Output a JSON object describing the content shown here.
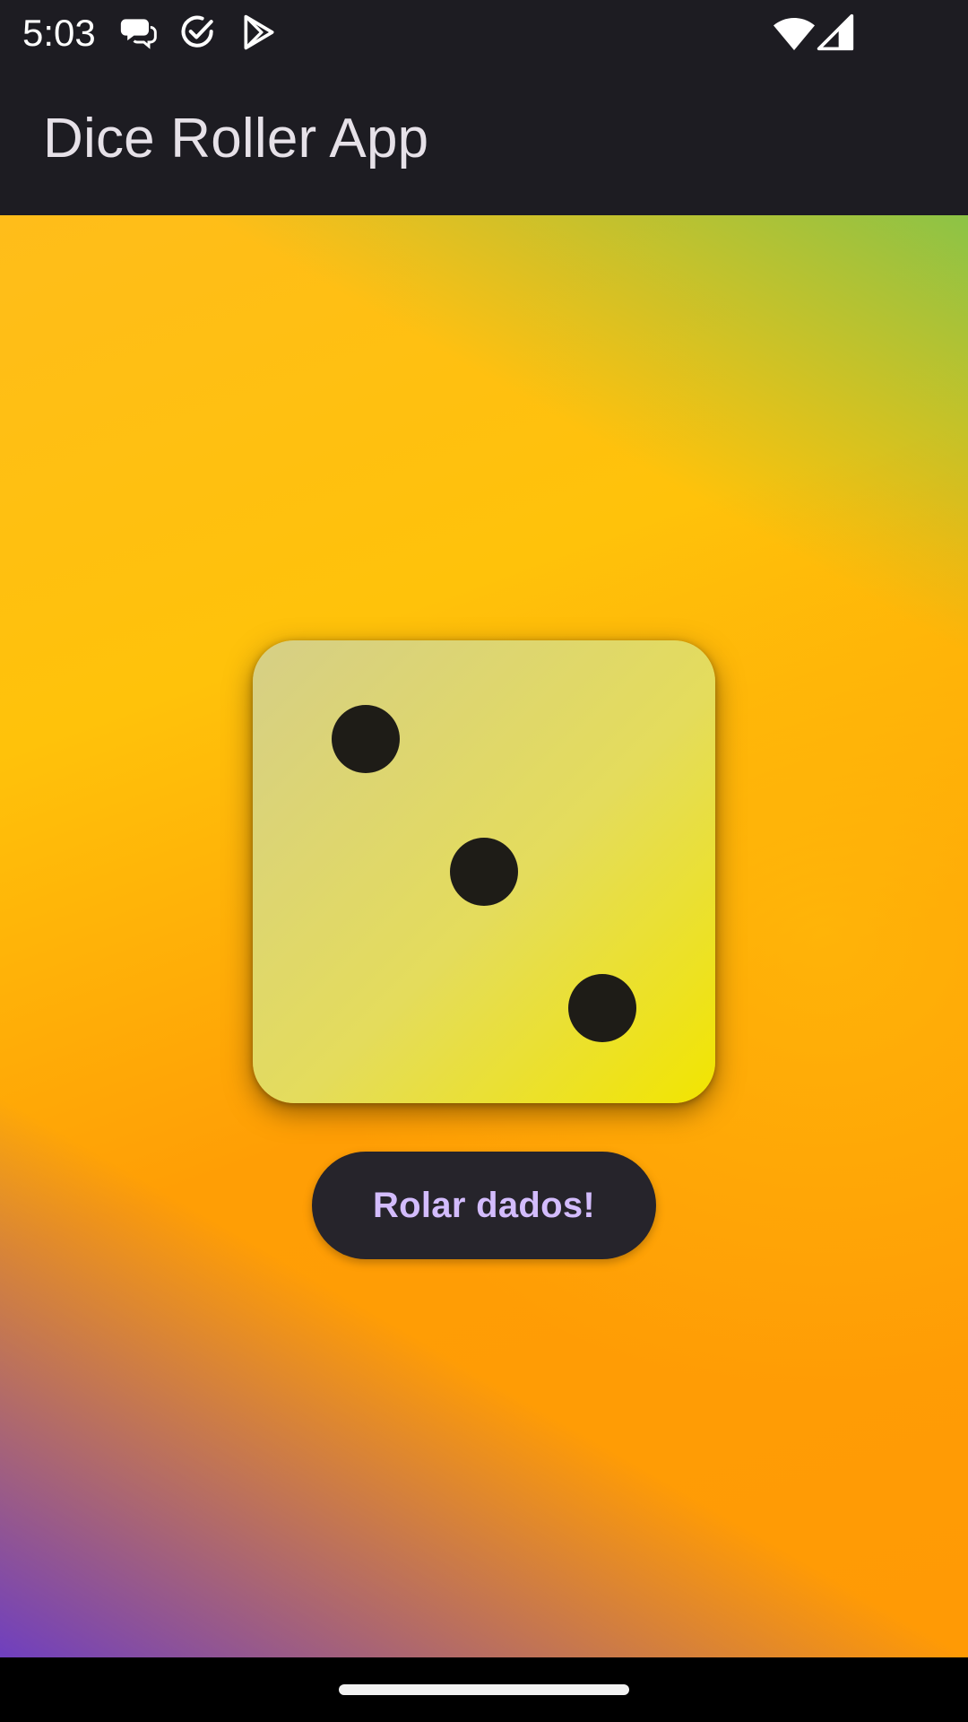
{
  "status_bar": {
    "time": "5:03",
    "left_icons": [
      "chat-bubbles-icon",
      "check-circle-icon",
      "play-store-icon"
    ],
    "right_icons": [
      "wifi-icon",
      "cell-signal-icon"
    ]
  },
  "app_bar": {
    "title": "Dice Roller App"
  },
  "dice": {
    "value": 3
  },
  "roll_button": {
    "label": "Rolar dados!"
  },
  "colors": {
    "bar_background": "#1d1c22",
    "button_background": "#26242b",
    "button_text": "#d3bcfd",
    "pip": "#1e1c17"
  }
}
